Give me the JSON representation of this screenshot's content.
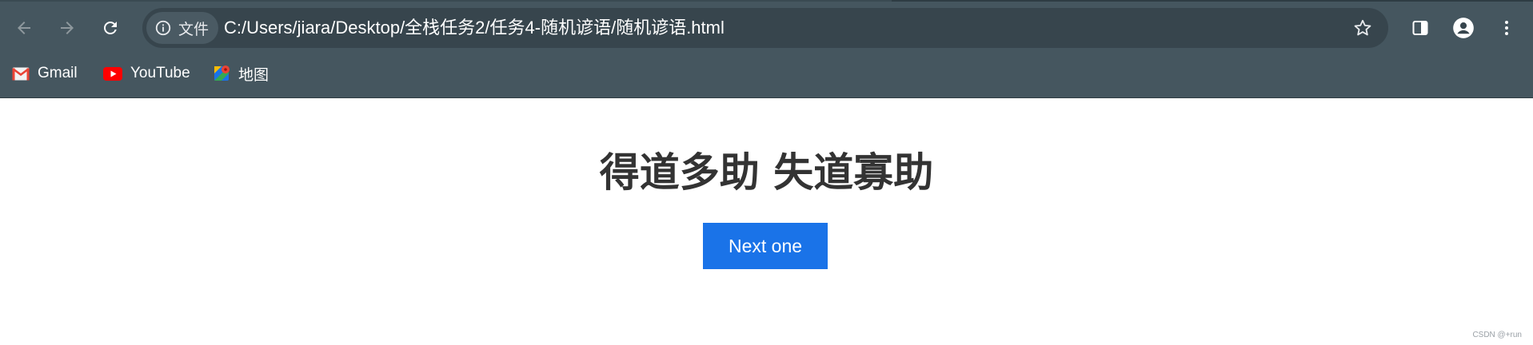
{
  "browser": {
    "chip_label": "文件",
    "url": "C:/Users/jiara/Desktop/全栈任务2/任务4-随机谚语/随机谚语.html",
    "bookmarks": [
      {
        "label": "Gmail",
        "icon": "gmail-icon"
      },
      {
        "label": "YouTube",
        "icon": "youtube-icon"
      },
      {
        "label": "地图",
        "icon": "maps-icon"
      }
    ]
  },
  "page": {
    "quote": "得道多助 失道寡助",
    "button_label": "Next one",
    "watermark": "CSDN @+run"
  },
  "colors": {
    "toolbar_bg": "#45565f",
    "omnibox_bg": "#37454d",
    "button_bg": "#1a73e8",
    "quote_text": "#333333"
  }
}
